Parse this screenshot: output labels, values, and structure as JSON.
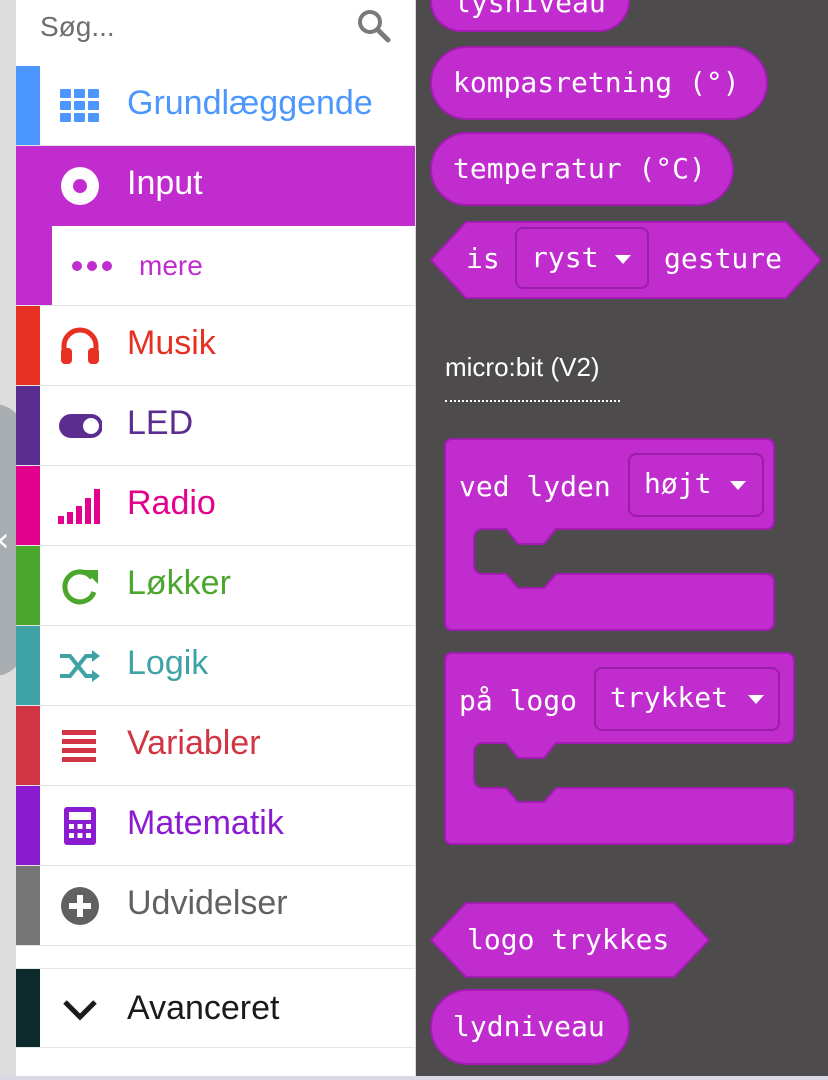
{
  "search": {
    "placeholder": "Søg..."
  },
  "toolbox": {
    "categories": [
      {
        "label": "Grundlæggende",
        "color": "#1e90ff",
        "icon": "grid-icon"
      },
      {
        "label": "Input",
        "color": "#c12ccf",
        "icon": "target-icon",
        "selected": true
      },
      {
        "label": "Musik",
        "color": "#e63022",
        "icon": "headphones-icon"
      },
      {
        "label": "LED",
        "color": "#5c2d91",
        "icon": "toggle-icon"
      },
      {
        "label": "Radio",
        "color": "#e3008c",
        "icon": "signal-bars-icon"
      },
      {
        "label": "Løkker",
        "color": "#00aa00",
        "icon": "refresh-icon"
      },
      {
        "label": "Logik",
        "color": "#00a4a6",
        "icon": "shuffle-icon"
      },
      {
        "label": "Variabler",
        "color": "#dc143c",
        "icon": "list-icon"
      },
      {
        "label": "Matematik",
        "color": "#9400d3",
        "icon": "calculator-icon"
      },
      {
        "label": "Udvidelser",
        "color": "#757575",
        "icon": "plus-circle-icon"
      }
    ],
    "sub_item": {
      "label": "mere",
      "icon": "ellipsis-icon"
    },
    "advanced": {
      "label": "Avanceret",
      "icon": "chevron-down-icon"
    }
  },
  "flyout": {
    "block_color": "#c12ccf",
    "partial_top_block": "lysniveau",
    "compass_block": "kompasretning (°)",
    "temperature_block": "temperatur (°C)",
    "gesture_block": {
      "prefix": "is",
      "dropdown": "ryst",
      "suffix": "gesture"
    },
    "section_label": "micro:bit (V2)",
    "sound_event_block": {
      "label": "ved lyden",
      "dropdown": "højt"
    },
    "logo_event_block": {
      "label": "på logo",
      "dropdown": "trykket"
    },
    "logo_pressed_block": "logo trykkes",
    "sound_level_block": "lydniveau"
  }
}
